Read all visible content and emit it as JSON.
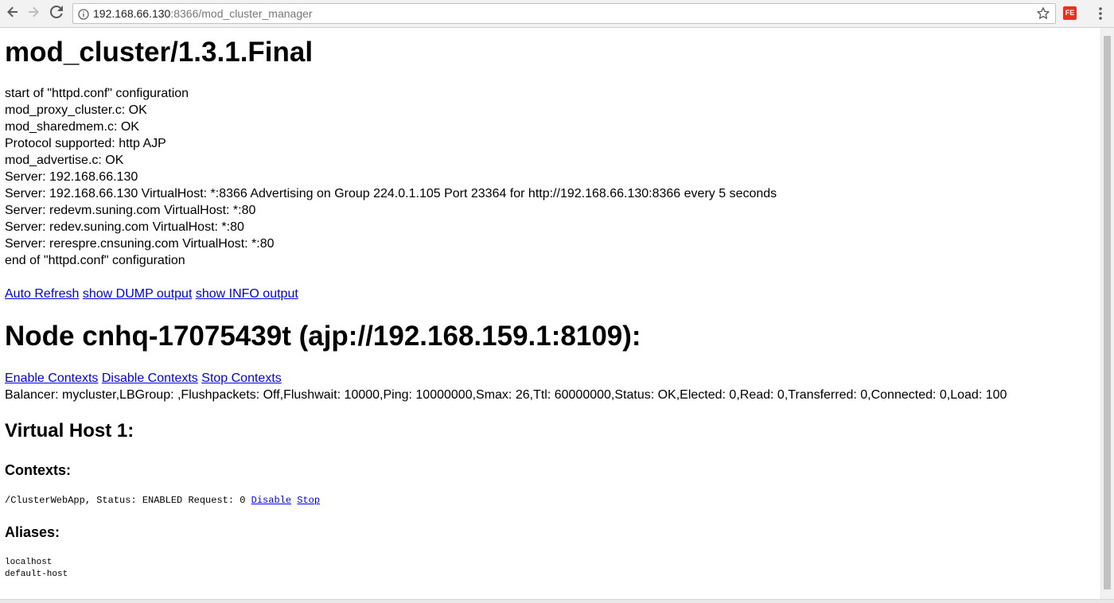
{
  "browser": {
    "url_host": "192.168.66.130",
    "url_rest": ":8366/mod_cluster_manager",
    "extension_label": "FE"
  },
  "page": {
    "title": "mod_cluster/1.3.1.Final",
    "conf_lines": [
      "start of \"httpd.conf\" configuration",
      "mod_proxy_cluster.c: OK",
      "mod_sharedmem.c: OK",
      "Protocol supported: http AJP",
      "mod_advertise.c: OK",
      "Server: 192.168.66.130",
      "Server: 192.168.66.130 VirtualHost: *:8366 Advertising on Group 224.0.1.105 Port 23364 for http://192.168.66.130:8366 every 5 seconds",
      "Server: redevm.suning.com VirtualHost: *:80",
      "Server: redev.suning.com VirtualHost: *:80",
      "Server: rerespre.cnsuning.com VirtualHost: *:80",
      "end of \"httpd.conf\" configuration"
    ],
    "top_links": {
      "auto_refresh": "Auto Refresh",
      "show_dump": "show DUMP output",
      "show_info": "show INFO output"
    },
    "node_heading": "Node cnhq-17075439t (ajp://192.168.159.1:8109):",
    "node_links": {
      "enable": "Enable Contexts",
      "disable": "Disable Contexts",
      "stop": "Stop Contexts"
    },
    "balancer_line": "Balancer: mycluster,LBGroup: ,Flushpackets: Off,Flushwait: 10000,Ping: 10000000,Smax: 26,Ttl: 60000000,Status: OK,Elected: 0,Read: 0,Transferred: 0,Connected: 0,Load: 100",
    "virtual_host_heading": "Virtual Host 1:",
    "contexts_heading": "Contexts:",
    "context_row": {
      "text": "/ClusterWebApp, Status: ENABLED Request: 0 ",
      "disable_link": "Disable",
      "stop_link": "Stop"
    },
    "aliases_heading": "Aliases:",
    "aliases": [
      "localhost",
      "default-host"
    ]
  }
}
